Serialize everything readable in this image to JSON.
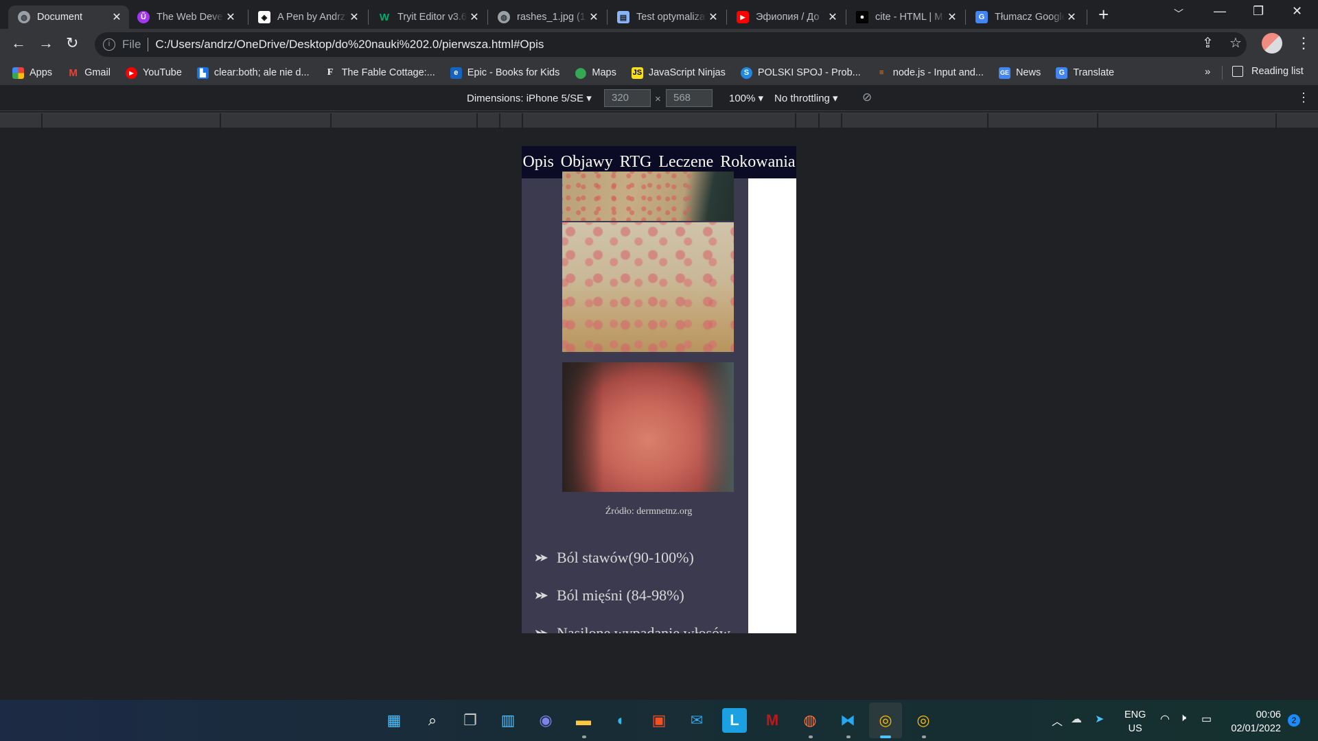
{
  "browser": {
    "tabs": [
      {
        "title": "Document",
        "icon": "globe-icon",
        "active": true
      },
      {
        "title": "The Web Developer",
        "icon": "udemy-icon",
        "active": false
      },
      {
        "title": "A Pen by Andrz",
        "icon": "codepen-icon",
        "active": false
      },
      {
        "title": "Tryit Editor v3.6",
        "icon": "w3schools-icon",
        "active": false
      },
      {
        "title": "rashes_1.jpg (1",
        "icon": "globe-icon",
        "active": false
      },
      {
        "title": "Test optymalizacji",
        "icon": "mobile-test-icon",
        "active": false
      },
      {
        "title": "Эфиопия / До",
        "icon": "youtube-icon",
        "active": false
      },
      {
        "title": "cite - HTML | M",
        "icon": "mdn-icon",
        "active": false
      },
      {
        "title": "Tłumacz Google",
        "icon": "google-translate-icon",
        "active": false
      }
    ],
    "address": {
      "scheme_label": "File",
      "url": "C:/Users/andrz/OneDrive/Desktop/do%20nauki%202.0/pierwsza.html#Opis"
    },
    "bookmarks": [
      {
        "label": "Apps",
        "icon": "apps-grid-icon"
      },
      {
        "label": "Gmail",
        "icon": "gmail-icon"
      },
      {
        "label": "YouTube",
        "icon": "youtube-icon"
      },
      {
        "label": "clear:both; ale nie d...",
        "icon": "bookmark-site-icon"
      },
      {
        "label": "The Fable Cottage:...",
        "icon": "fable-cottage-icon"
      },
      {
        "label": "Epic - Books for Kids",
        "icon": "epic-icon"
      },
      {
        "label": "Maps",
        "icon": "maps-pin-icon"
      },
      {
        "label": "JavaScript Ninjas",
        "icon": "js-icon"
      },
      {
        "label": "POLSKI SPOJ - Prob...",
        "icon": "spoj-icon"
      },
      {
        "label": "node.js - Input and...",
        "icon": "stackoverflow-icon"
      },
      {
        "label": "News",
        "icon": "google-news-icon"
      },
      {
        "label": "Translate",
        "icon": "google-translate-icon"
      }
    ],
    "bookmarks_more": "»",
    "reading_list": "Reading list"
  },
  "devtools": {
    "dimensions_label": "Dimensions: iPhone 5/SE",
    "width": "320",
    "height": "568",
    "times": "×",
    "zoom": "100%",
    "throttling": "No throttling"
  },
  "page": {
    "nav": [
      "Opis",
      "Objawy",
      "RTG",
      "Leczene",
      "Rokowania"
    ],
    "caption": "Źródło: dermnetnz.org",
    "symptoms": [
      "Ból stawów(90-100%)",
      "Ból mięśni (84-98%)",
      "Nasilone wypadanie włosów"
    ],
    "bullet": "➤➤"
  },
  "taskbar": {
    "apps": [
      {
        "name": "start-icon",
        "glyph": "▦"
      },
      {
        "name": "search-icon",
        "glyph": "⌕"
      },
      {
        "name": "task-view-icon",
        "glyph": "❐"
      },
      {
        "name": "widgets-icon",
        "glyph": "▥"
      },
      {
        "name": "teams-chat-icon",
        "glyph": "◉"
      },
      {
        "name": "file-explorer-icon",
        "glyph": "▬"
      },
      {
        "name": "edge-icon",
        "glyph": "◐"
      },
      {
        "name": "ms-store-icon",
        "glyph": "▣"
      },
      {
        "name": "mail-icon",
        "glyph": "✉"
      },
      {
        "name": "l-app-icon",
        "glyph": "L"
      },
      {
        "name": "mcafee-icon",
        "glyph": "M"
      },
      {
        "name": "firefox-icon",
        "glyph": "◍"
      },
      {
        "name": "vscode-icon",
        "glyph": "⧓"
      },
      {
        "name": "chrome-icon",
        "glyph": "◎"
      },
      {
        "name": "chrome-icon",
        "glyph": "◎"
      }
    ],
    "lang_top": "ENG",
    "lang_bottom": "US",
    "time": "00:06",
    "date": "02/01/2022",
    "notifications": "2"
  }
}
